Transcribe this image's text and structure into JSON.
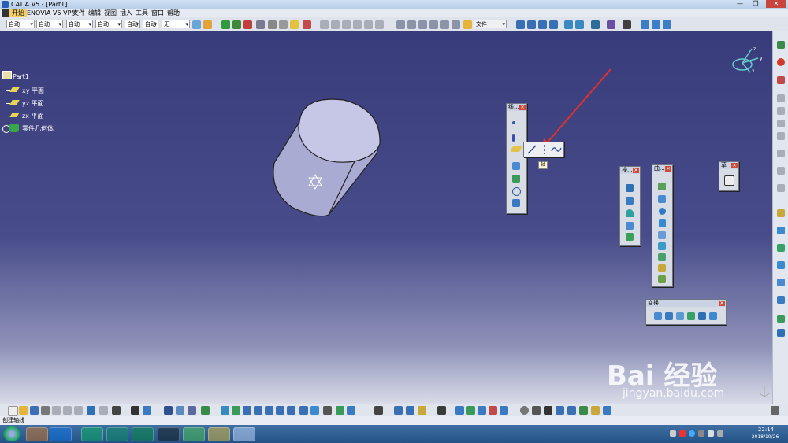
{
  "window": {
    "title": "CATIA V5 - [Part1]",
    "minimize": "—",
    "maximize": "❐",
    "close": "✕"
  },
  "menu": [
    "开始",
    "ENOVIA V5 VPM",
    "文件",
    "编辑",
    "视图",
    "插入",
    "工具",
    "窗口",
    "帮助"
  ],
  "toolbar": {
    "dropdowns": [
      "自动",
      "自动",
      "自动",
      "自动",
      "自动",
      "自动",
      "无"
    ],
    "file_dropdown": "文件"
  },
  "tree": {
    "root": "Part1",
    "items": [
      "xy 平面",
      "yz 平面",
      "zx 平面",
      "零件几何体"
    ]
  },
  "palettes": {
    "wireframe_title": "线...",
    "tooltip": "轴",
    "ops_title": "操...",
    "surface_title": "曲...",
    "sketch_title": "草",
    "transform_title": "变换"
  },
  "status": {
    "text": "创建轴线"
  },
  "clock": {
    "time": "22:14",
    "date": "2018/10/26"
  },
  "watermark": {
    "brand": "Bai 经验",
    "url": "jingyan.baidu.com"
  },
  "colors": {
    "viewport_top": "#383c7b",
    "viewport_bottom": "#d9dbe8",
    "cylinder": "#b8badd",
    "arrow": "#e0322a"
  }
}
